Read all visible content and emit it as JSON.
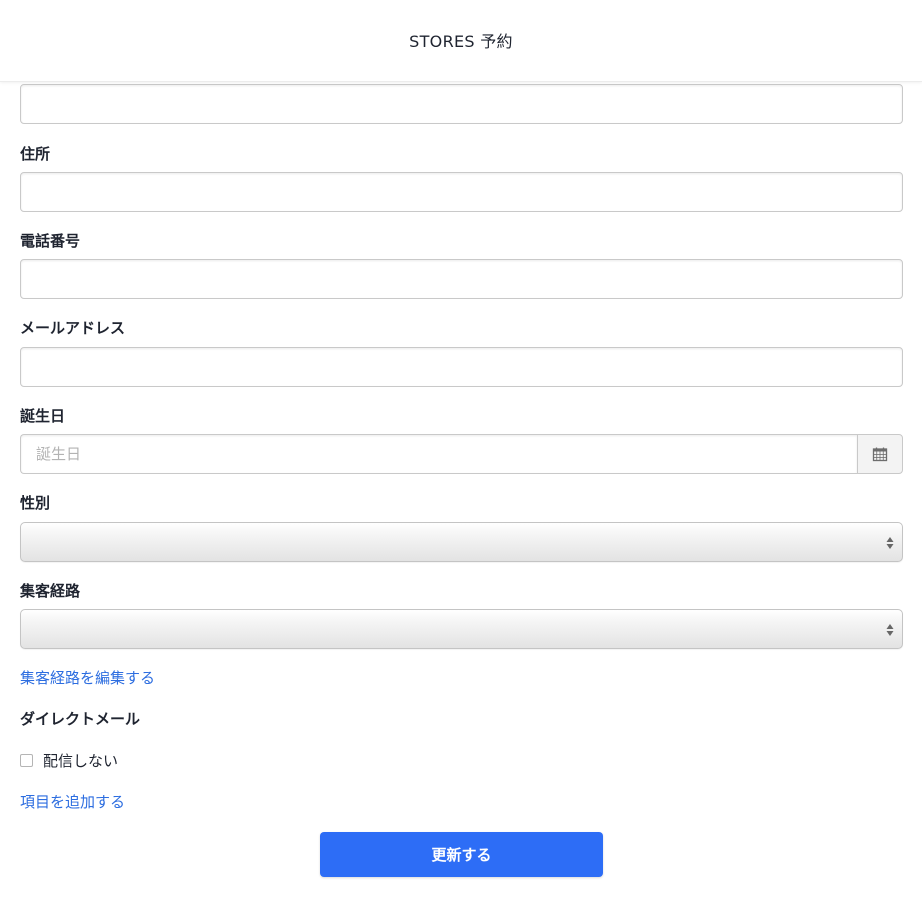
{
  "header": {
    "title": "STORES 予約"
  },
  "form": {
    "address_label": "住所",
    "phone_label": "電話番号",
    "email_label": "メールアドレス",
    "birthday_label": "誕生日",
    "birthday_placeholder": "誕生日",
    "gender_label": "性別",
    "channel_label": "集客経路",
    "edit_channel_link": "集客経路を編集する",
    "direct_mail_label": "ダイレクトメール",
    "no_delivery_label": "配信しない",
    "add_item_link": "項目を追加する",
    "submit_label": "更新する"
  },
  "icons": {
    "calendar": "calendar-icon",
    "select_arrows": "chevron-updown-icon"
  },
  "colors": {
    "primary": "#2d6df6",
    "link": "#2c6de0"
  }
}
